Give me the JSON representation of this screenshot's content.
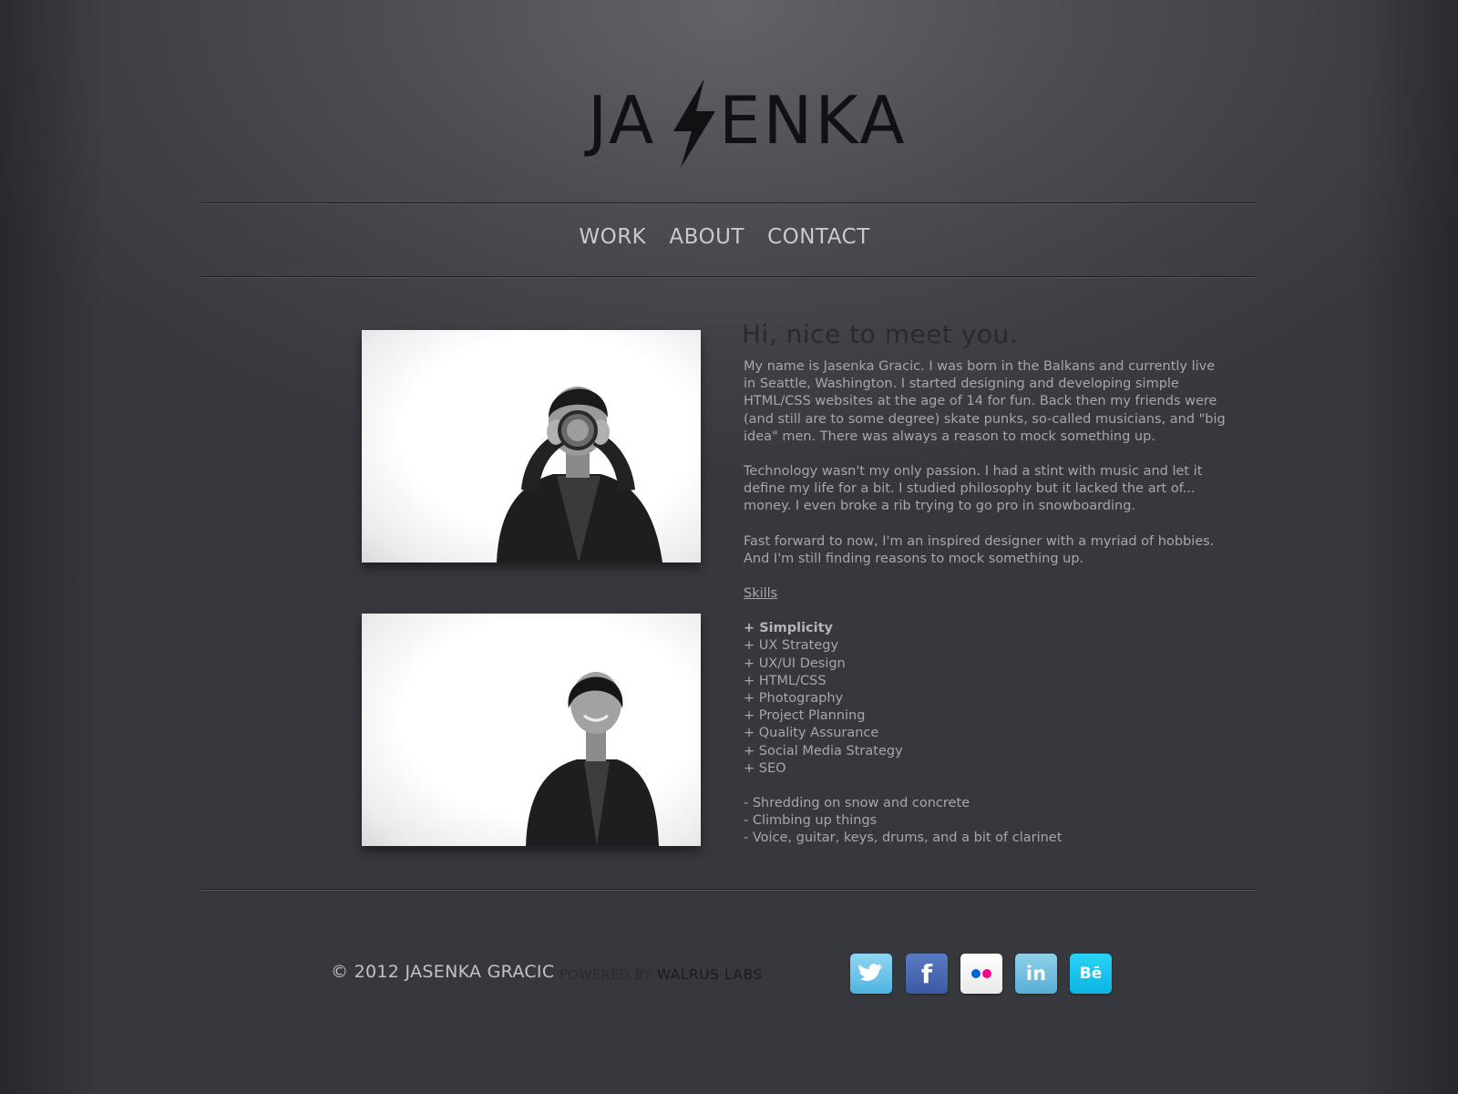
{
  "header": {
    "logo_left": "JA",
    "logo_right": "ENKA"
  },
  "nav": {
    "items": [
      "WORK",
      "ABOUT",
      "CONTACT"
    ]
  },
  "about": {
    "heading": "Hi, nice to meet you.",
    "paragraphs": [
      "My name is Jasenka Gracic. I was born in the Balkans and currently live in Seattle, Washington. I started designing and developing simple HTML/CSS websites at the age of 14 for fun. Back then my friends were (and still are to some degree) skate punks, so-called musicians, and \"big idea\" men. There was always a reason to mock something up.",
      "Technology wasn't my only passion. I had a stint with music and let it define my life for a bit. I studied philosophy but it lacked the art of... money. I even broke a rib trying to go pro in snowboarding.",
      "Fast forward to now, I'm an inspired designer with a myriad of hobbies. And I'm still finding reasons to mock something up."
    ],
    "skills_label": "Skills",
    "skills": [
      "+ Simplicity",
      "+ UX Strategy",
      "+ UX/UI Design",
      "+ HTML/CSS",
      "+ Photography",
      "+ Project Planning",
      "+ Quality Assurance",
      "+ Social Media Strategy",
      "+ SEO"
    ],
    "hobbies": [
      "- Shredding on snow and concrete",
      "- Climbing up things",
      "- Voice, guitar, keys, drums, and a bit of clarinet"
    ]
  },
  "footer": {
    "copyright": "© 2012 JASENKA GRACIC",
    "powered_by": "POWERED BY",
    "powered_brand": "WALRUS LABS",
    "social": [
      {
        "icon": "twitter-icon",
        "glyph": ""
      },
      {
        "icon": "facebook-icon",
        "glyph": "f"
      },
      {
        "icon": "flickr-icon",
        "glyph": ""
      },
      {
        "icon": "linkedin-icon",
        "glyph": "in"
      },
      {
        "icon": "behance-icon",
        "glyph": "Bē"
      }
    ]
  },
  "colors": {
    "background": "#4b4c52",
    "text": "#a6a6ac",
    "heading": "#2a2a2e",
    "nav": "#c9c9cd",
    "twitter": "#4fb4e2",
    "facebook": "#3a5ba3",
    "linkedin": "#58aed6",
    "behance": "#0cb4e4",
    "flickr_blue": "#0063dc",
    "flickr_pink": "#ff0084"
  }
}
